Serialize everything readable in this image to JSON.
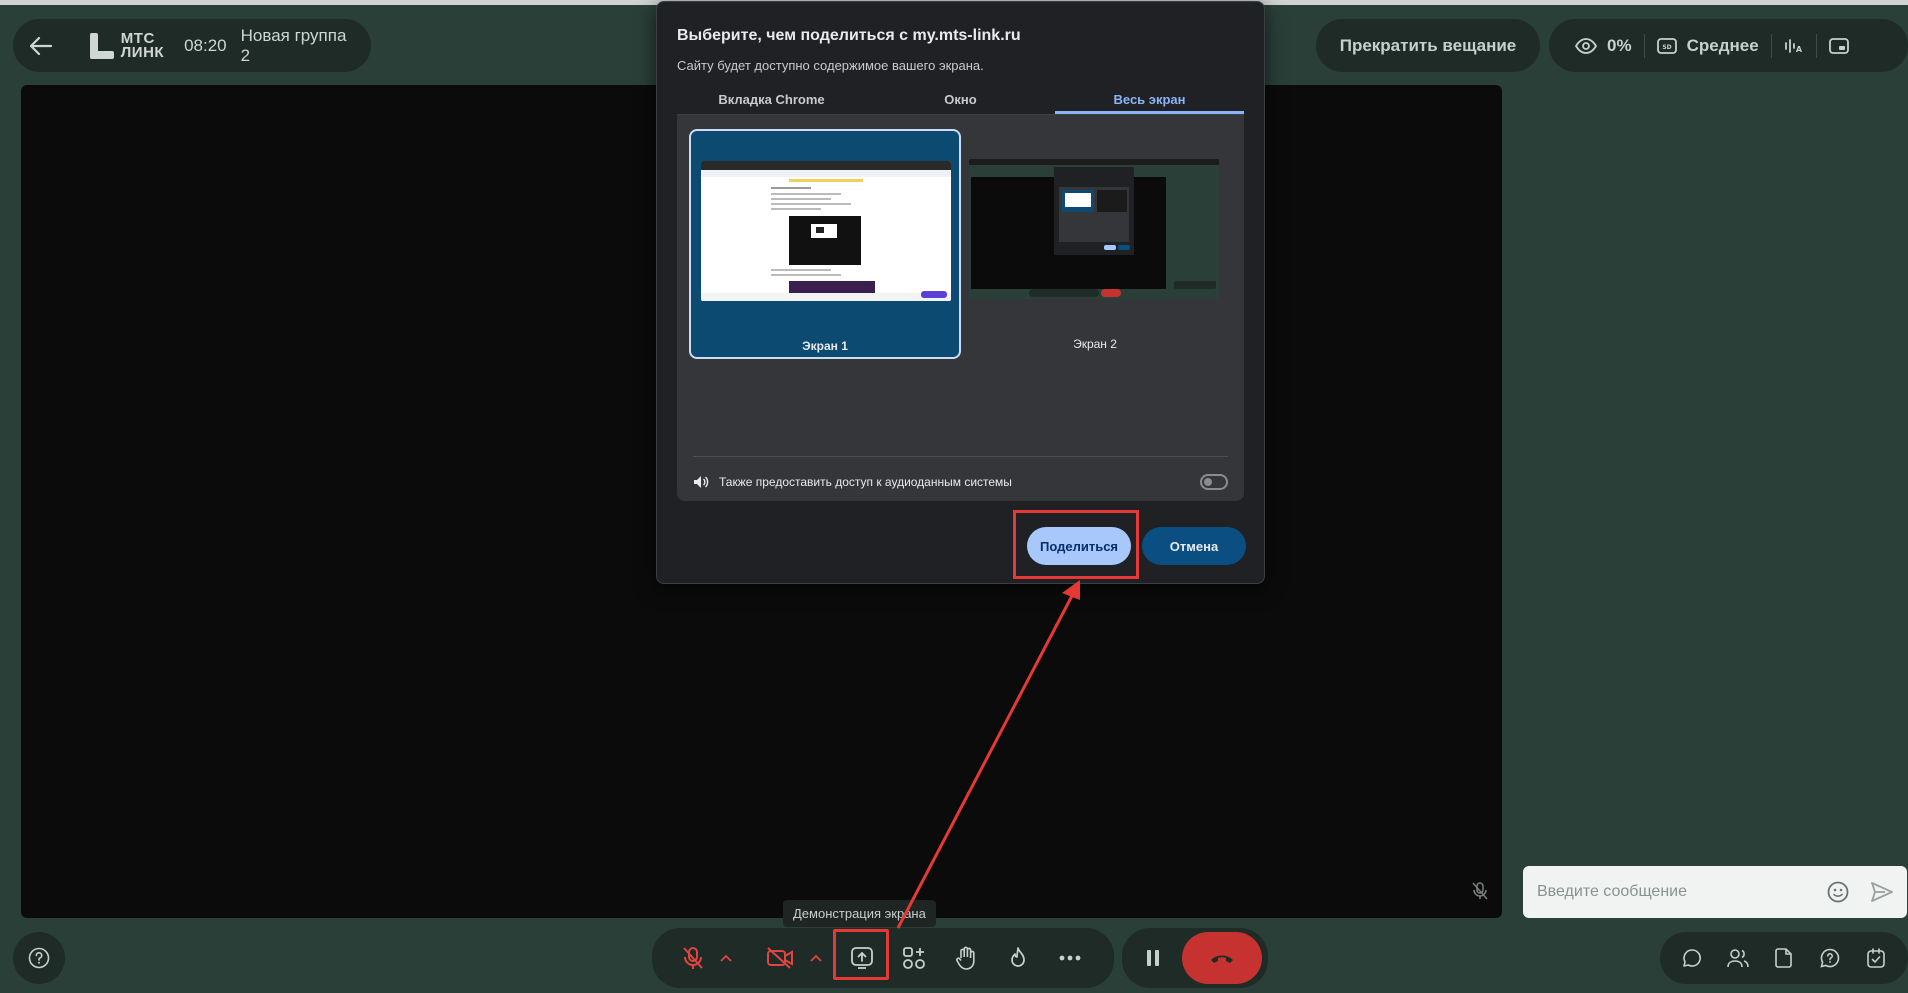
{
  "header": {
    "logo_line1": "МТС",
    "logo_line2": "ЛИНК",
    "time": "08:20",
    "group_name": "Новая группа 2",
    "stop_broadcast_label": "Прекратить вещание",
    "viewers_percent": "0%",
    "quality_label": "Среднее"
  },
  "dialog": {
    "title": "Выберите, чем поделиться с my.mts-link.ru",
    "subtitle": "Сайту будет доступно содержимое вашего экрана.",
    "tabs": [
      {
        "label": "Вкладка Chrome",
        "active": false
      },
      {
        "label": "Окно",
        "active": false
      },
      {
        "label": "Весь экран",
        "active": true
      }
    ],
    "screens": [
      {
        "label": "Экран 1",
        "selected": true
      },
      {
        "label": "Экран 2",
        "selected": false
      }
    ],
    "audio_label": "Также предоставить доступ к аудиоданным системы",
    "audio_enabled": false,
    "share_label": "Поделиться",
    "cancel_label": "Отмена"
  },
  "chat": {
    "placeholder": "Введите сообщение"
  },
  "toolbar": {
    "tooltip": "Демонстрация экрана"
  },
  "colors": {
    "background": "#2b3f39",
    "panel": "#1e2b27",
    "stage": "#0b0b0b",
    "end_call": "#c6322f",
    "dialog_bg": "#202124",
    "accent_blue": "#8ab4f8",
    "annotation_red": "#e53935"
  }
}
